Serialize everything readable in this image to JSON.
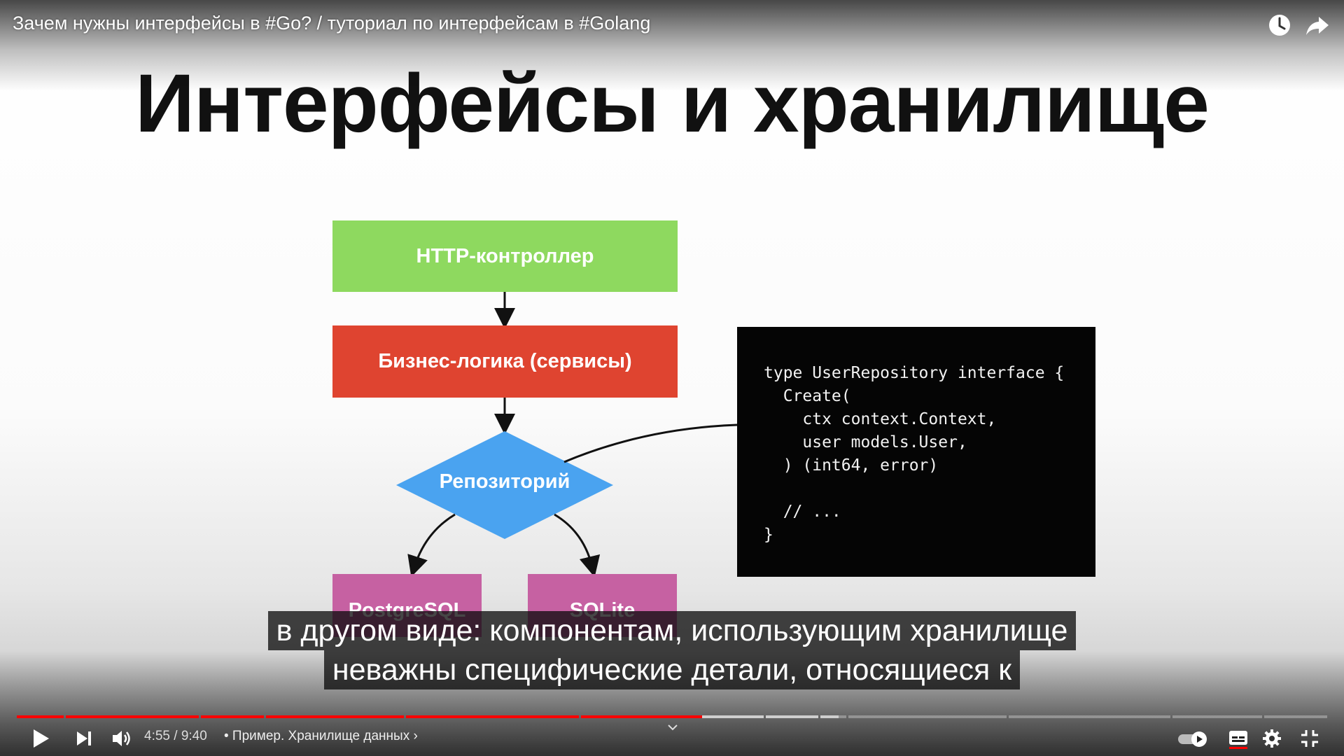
{
  "video": {
    "title": "Зачем нужны интерфейсы в #Go? / туториал по интерфейсам в #Golang"
  },
  "top_icons": [
    "watch-later-icon",
    "share-icon"
  ],
  "slide": {
    "title": "Интерфейсы и хранилище",
    "diagram": {
      "http_controller": "HTTP-контроллер",
      "business_logic": "Бизнес-логика (сервисы)",
      "repository": "Репозиторий",
      "postgres": "PostgreSQL",
      "sqlite": "SQLite"
    },
    "code_lines": [
      "type UserRepository interface {",
      "  Create(",
      "    ctx context.Context,",
      "    user models.User,",
      "  ) (int64, error)",
      "",
      "  // ...",
      "}"
    ],
    "colors": {
      "http": "#8ed95f",
      "business": "#df4430",
      "repository": "#4aa3f0",
      "storage": "#c661a2"
    }
  },
  "subtitles": {
    "line1": "в другом виде: компонентам, использующим хранилище",
    "line2": "неважны специфические детали, относящиеся к"
  },
  "player": {
    "current_time": "4:55",
    "separator": " / ",
    "duration": "9:40",
    "chapter": "• Пример. Хранилище данных",
    "chapter_chevron": "›",
    "progress_fraction": 0.523,
    "buffered_fraction": 0.627,
    "accent": "#ff0000",
    "autoplay_on": true,
    "icons": [
      "play-icon",
      "next-icon",
      "volume-icon",
      "chevron-down-icon",
      "autoplay-toggle",
      "subtitles-icon",
      "settings-icon",
      "exit-fullscreen-icon"
    ]
  }
}
